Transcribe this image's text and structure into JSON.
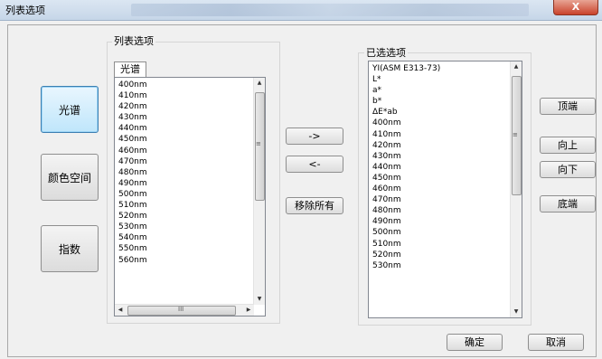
{
  "window": {
    "title": "列表选项",
    "close_label": "X"
  },
  "categories": [
    {
      "label": "光谱",
      "selected": true
    },
    {
      "label": "颜色空间",
      "selected": false
    },
    {
      "label": "指数",
      "selected": false
    }
  ],
  "list_options": {
    "group_label": "列表选项",
    "tab_label": "光谱",
    "items": [
      "400nm",
      "410nm",
      "420nm",
      "430nm",
      "440nm",
      "450nm",
      "460nm",
      "470nm",
      "480nm",
      "490nm",
      "500nm",
      "510nm",
      "520nm",
      "530nm",
      "540nm",
      "550nm",
      "560nm"
    ]
  },
  "transfer": {
    "add_label": "->",
    "remove_label": "<-",
    "remove_all_label": "移除所有"
  },
  "selected_options": {
    "group_label": "已选选项",
    "items": [
      "YI(ASM E313-73)",
      "L*",
      "a*",
      "b*",
      "ΔE*ab",
      "400nm",
      "410nm",
      "420nm",
      "430nm",
      "440nm",
      "450nm",
      "460nm",
      "470nm",
      "480nm",
      "490nm",
      "500nm",
      "510nm",
      "520nm",
      "530nm"
    ]
  },
  "order": {
    "top_label": "顶端",
    "up_label": "向上",
    "down_label": "向下",
    "bottom_label": "底端"
  },
  "footer": {
    "ok_label": "确定",
    "cancel_label": "取消"
  }
}
